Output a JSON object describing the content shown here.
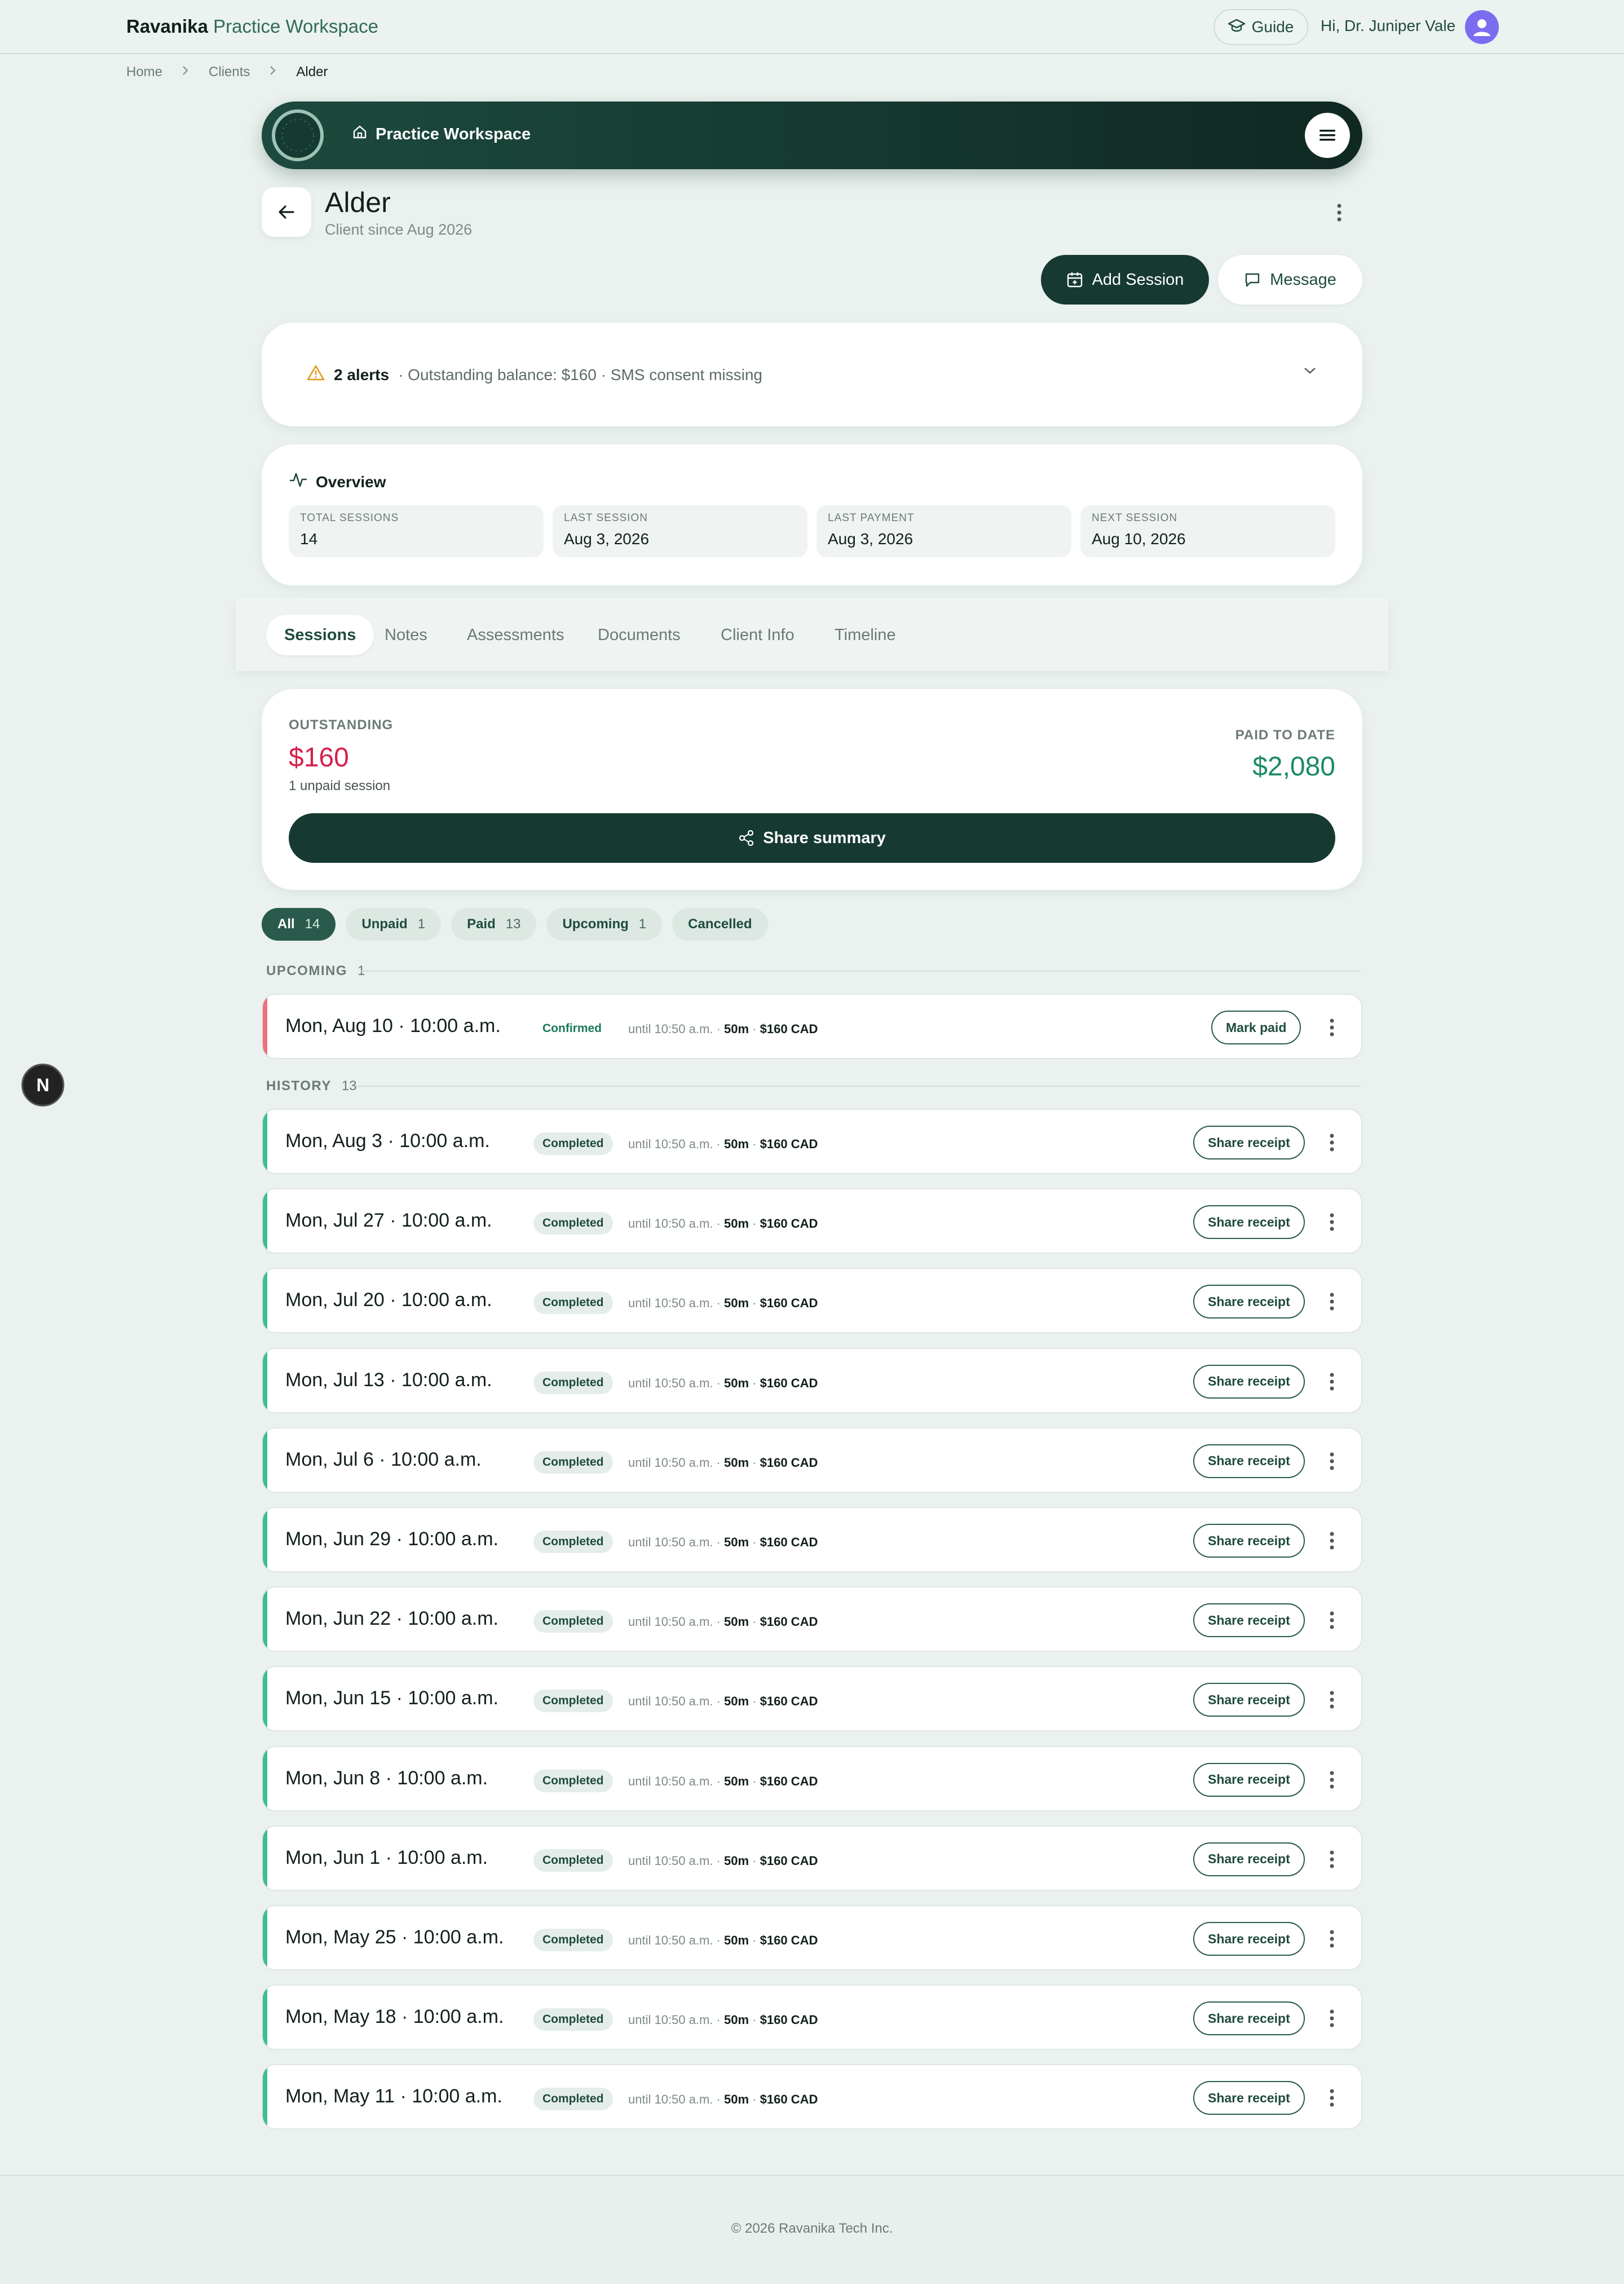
{
  "topbar": {
    "brand_primary": "Ravanika",
    "brand_secondary": "Practice Workspace",
    "guide_label": "Guide",
    "greeting": "Hi, Dr. Juniper Vale"
  },
  "breadcrumb": [
    "Home",
    "Clients",
    "Alder"
  ],
  "banner": {
    "title": "Practice Workspace"
  },
  "client": {
    "name": "Alder",
    "since": "Client since Aug 2026"
  },
  "actions": {
    "add_session": "Add Session",
    "message": "Message"
  },
  "alerts": {
    "count_label": "2 alerts",
    "detail": "· Outstanding balance: $160 · SMS consent missing"
  },
  "overview": {
    "title": "Overview",
    "stats": [
      {
        "label": "TOTAL SESSIONS",
        "value": "14"
      },
      {
        "label": "LAST SESSION",
        "value": "Aug 3, 2026"
      },
      {
        "label": "LAST PAYMENT",
        "value": "Aug 3, 2026"
      },
      {
        "label": "NEXT SESSION",
        "value": "Aug 10, 2026"
      }
    ]
  },
  "tabs": [
    "Sessions",
    "Notes",
    "Assessments",
    "Documents",
    "Client Info",
    "Timeline"
  ],
  "balance": {
    "outstanding_label": "OUTSTANDING",
    "outstanding_value": "$160",
    "outstanding_sub": "1 unpaid session",
    "paid_label": "PAID TO DATE",
    "paid_value": "$2,080",
    "share_label": "Share summary"
  },
  "filters": [
    {
      "label": "All",
      "count": "14"
    },
    {
      "label": "Unpaid",
      "count": "1"
    },
    {
      "label": "Paid",
      "count": "13"
    },
    {
      "label": "Upcoming",
      "count": "1"
    },
    {
      "label": "Cancelled",
      "count": ""
    }
  ],
  "sections": {
    "upcoming": {
      "label": "UPCOMING",
      "count": "1"
    },
    "history": {
      "label": "HISTORY",
      "count": "13"
    }
  },
  "session_meta": {
    "until": "until 10:50 a.m. ·",
    "duration": "50m",
    "sep": "·",
    "price": "$160 CAD"
  },
  "upcoming_sessions": [
    {
      "date": "Mon, Aug 10 · 10:00 a.m.",
      "status": "Confirmed",
      "action": "Mark paid"
    }
  ],
  "history_sessions": [
    {
      "date": "Mon, Aug 3 · 10:00 a.m.",
      "status": "Completed",
      "action": "Share receipt"
    },
    {
      "date": "Mon, Jul 27 · 10:00 a.m.",
      "status": "Completed",
      "action": "Share receipt"
    },
    {
      "date": "Mon, Jul 20 · 10:00 a.m.",
      "status": "Completed",
      "action": "Share receipt"
    },
    {
      "date": "Mon, Jul 13 · 10:00 a.m.",
      "status": "Completed",
      "action": "Share receipt"
    },
    {
      "date": "Mon, Jul 6 · 10:00 a.m.",
      "status": "Completed",
      "action": "Share receipt"
    },
    {
      "date": "Mon, Jun 29 · 10:00 a.m.",
      "status": "Completed",
      "action": "Share receipt"
    },
    {
      "date": "Mon, Jun 22 · 10:00 a.m.",
      "status": "Completed",
      "action": "Share receipt"
    },
    {
      "date": "Mon, Jun 15 · 10:00 a.m.",
      "status": "Completed",
      "action": "Share receipt"
    },
    {
      "date": "Mon, Jun 8 · 10:00 a.m.",
      "status": "Completed",
      "action": "Share receipt"
    },
    {
      "date": "Mon, Jun 1 · 10:00 a.m.",
      "status": "Completed",
      "action": "Share receipt"
    },
    {
      "date": "Mon, May 25 · 10:00 a.m.",
      "status": "Completed",
      "action": "Share receipt"
    },
    {
      "date": "Mon, May 18 · 10:00 a.m.",
      "status": "Completed",
      "action": "Share receipt"
    },
    {
      "date": "Mon, May 11 · 10:00 a.m.",
      "status": "Completed",
      "action": "Share receipt"
    }
  ],
  "fab_label": "N",
  "footer": "© 2026 Ravanika Tech Inc.",
  "colors": {
    "accent_dark": "#163a31",
    "outstanding": "#d6204c",
    "paid": "#1b8a68",
    "completed_bar": "#3fbd8e",
    "upcoming_bar": "#ee6f7d"
  }
}
